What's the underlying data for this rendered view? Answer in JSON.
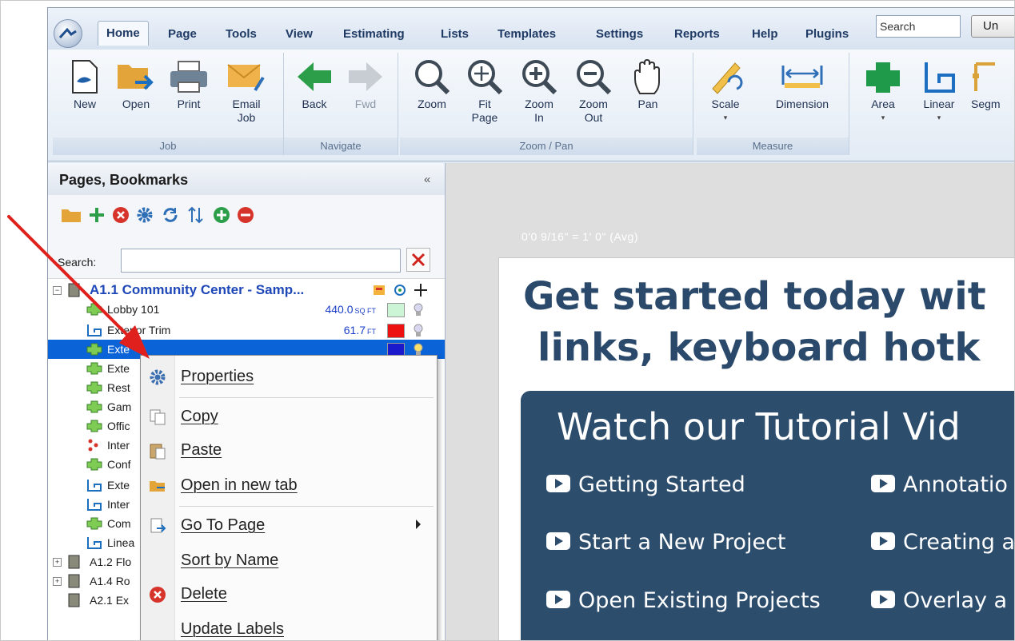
{
  "ribbon": {
    "tabs": [
      "Home",
      "Page",
      "Tools",
      "View",
      "Estimating",
      "Lists",
      "Templates",
      "Settings",
      "Reports",
      "Help",
      "Plugins"
    ],
    "active_tab": "Home",
    "search_placeholder": "Search",
    "undo_label": "Un",
    "groups": {
      "job": {
        "label": "Job",
        "buttons": [
          "New",
          "Open",
          "Print",
          "Email Job"
        ]
      },
      "navigate": {
        "label": "Navigate",
        "buttons": [
          "Back",
          "Fwd"
        ]
      },
      "zoom": {
        "label": "Zoom / Pan",
        "buttons": [
          "Zoom",
          "Fit Page",
          "Zoom In",
          "Zoom Out",
          "Pan"
        ]
      },
      "measure": {
        "label": "Measure",
        "buttons": [
          "Scale",
          "Dimension"
        ]
      },
      "takeoff": {
        "buttons": [
          "Area",
          "Linear",
          "Segm"
        ]
      }
    }
  },
  "panel": {
    "title": "Pages, Bookmarks",
    "collapse": "«",
    "search_label": "Search:"
  },
  "tree": {
    "page_title": "A1.1 Community Center - Samp...",
    "items": [
      {
        "label": "Lobby 101",
        "value": "440.0",
        "unit": "SQ FT",
        "color": "#ccf5d6"
      },
      {
        "label": "Exterior Trim",
        "value": "61.7",
        "unit": "FT",
        "color": "#ee1111"
      },
      {
        "label": "Exte",
        "value": "",
        "unit": "",
        "color": "#1a1acc"
      },
      {
        "label": "Exte"
      },
      {
        "label": "Rest"
      },
      {
        "label": "Gam"
      },
      {
        "label": "Offic"
      },
      {
        "label": "Inter"
      },
      {
        "label": "Conf"
      },
      {
        "label": "Exte"
      },
      {
        "label": "Inter"
      },
      {
        "label": "Com"
      },
      {
        "label": "Linea"
      }
    ],
    "pages": [
      "A1.2 Flo",
      "A1.4 Ro",
      "A2.1 Ex"
    ]
  },
  "context_menu": {
    "items": [
      "Properties",
      "Copy",
      "Paste",
      "Open in new tab",
      "Go To Page",
      "Sort by Name",
      "Delete",
      "Update Labels"
    ]
  },
  "viewer": {
    "scale_text": "0'0 9/16\" = 1' 0\" (Avg)",
    "headline_1": "Get started today wit",
    "headline_2": "links, keyboard hotk",
    "box_title": "Watch our Tutorial Vid",
    "links_left": [
      "Getting Started",
      "Start a New Project",
      "Open Existing Projects"
    ],
    "links_right": [
      "Annotatio",
      "Creating a",
      "Overlay a"
    ]
  },
  "colors": {
    "accent_blue": "#1e47b8",
    "tutorial_box": "#2d4d6d",
    "arrow_red": "#e0201c"
  }
}
